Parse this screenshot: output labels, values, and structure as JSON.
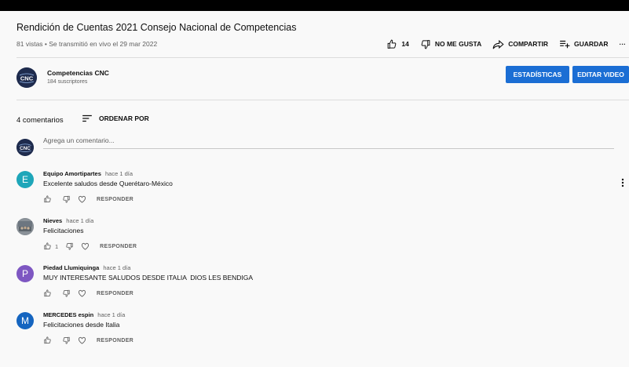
{
  "video": {
    "title": "Rendición de Cuentas 2021 Consejo Nacional de Competencias",
    "meta": "81 vistas • Se transmitió en vivo el 29 mar 2022"
  },
  "actions": {
    "like_count": "14",
    "dislike_label": "NO ME GUSTA",
    "share_label": "COMPARTIR",
    "save_label": "GUARDAR",
    "more_label": "···"
  },
  "channel": {
    "avatar_text": "CNC",
    "name": "Competencias CNC",
    "subscribers": "184 suscriptores"
  },
  "buttons": {
    "stats": "ESTADÍSTICAS",
    "edit": "EDITAR VIDEO"
  },
  "comments_header": {
    "count": "4 comentarios",
    "sort_label": "ORDENAR POR"
  },
  "new_comment": {
    "avatar_text": "CNC",
    "placeholder": "Agrega un comentario..."
  },
  "comments": [
    {
      "avatar_letter": "E",
      "avatar_color": "#1ea6b9",
      "author": "Equipo Amortipartes",
      "time": "hace 1 día",
      "text": "Excelente saludos desde Querétaro-México",
      "like_count": "",
      "reply_label": "RESPONDER"
    },
    {
      "avatar_letter": "",
      "avatar_color": "#7d848c",
      "author": "Nieves",
      "time": "hace 1 día",
      "text": "Felicitaciones",
      "like_count": "1",
      "reply_label": "RESPONDER"
    },
    {
      "avatar_letter": "P",
      "avatar_color": "#7e57c2",
      "author": "Piedad Llumiquinga",
      "time": "hace 1 día",
      "text": "MUY INTERESANTE SALUDOS DESDE ITALIA  DIOS LES BENDIGA",
      "like_count": "",
      "reply_label": "RESPONDER"
    },
    {
      "avatar_letter": "M",
      "avatar_color": "#1565c0",
      "author": "MERCEDES espin",
      "time": "hace 1 día",
      "text": "Felicitaciones desde Italia",
      "like_count": "",
      "reply_label": "RESPONDER"
    }
  ],
  "colors": {
    "accent_blue": "#1b6ed4",
    "channel_avatar": "#1e2b4d"
  }
}
